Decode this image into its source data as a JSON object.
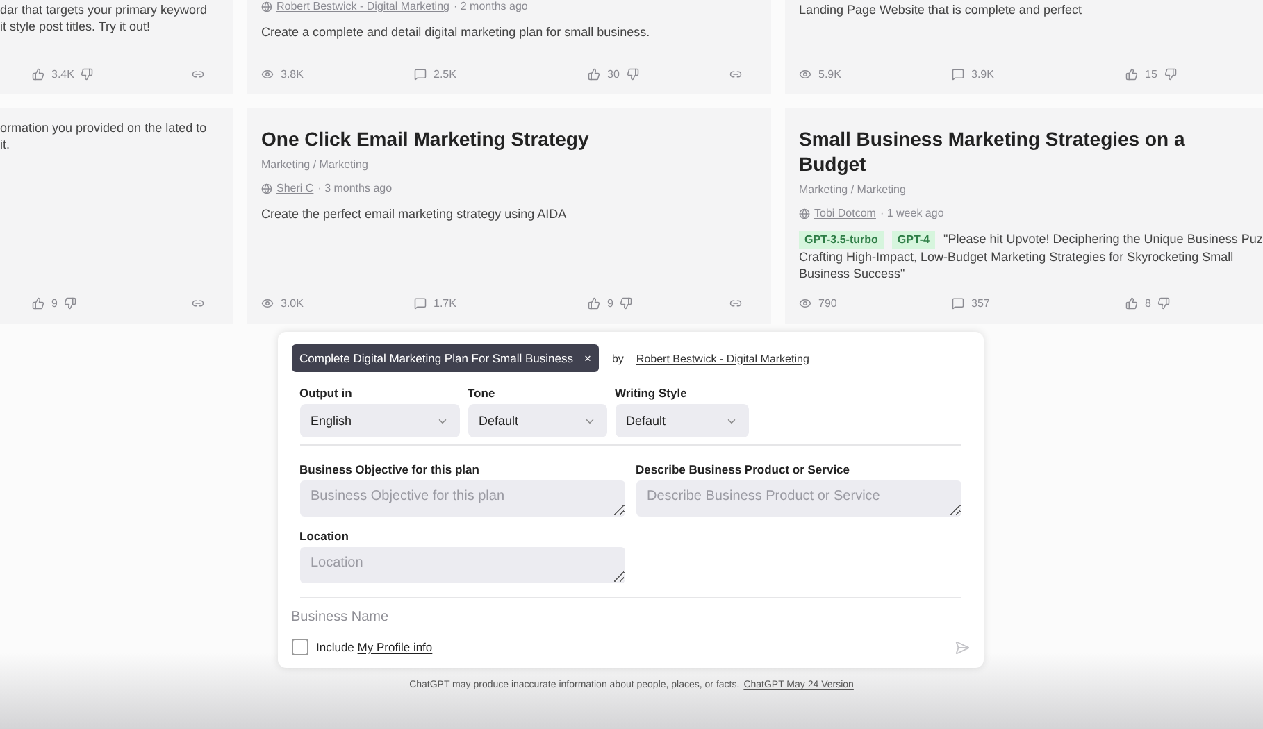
{
  "cards_top": [
    {
      "description": "dar that targets your primary keyword it style post titles. Try it out!",
      "stats": {
        "likes": "3.4K"
      }
    },
    {
      "author": "Robert Bestwick - Digital Marketing",
      "time": "· 2 months ago",
      "description": "Create a complete and detail digital marketing plan for small business.",
      "stats": {
        "views": "3.8K",
        "comments": "2.5K",
        "likes": "30"
      }
    },
    {
      "description": "Landing Page Website that is complete and perfect",
      "stats": {
        "views": "5.9K",
        "comments": "3.9K",
        "likes": "15"
      }
    }
  ],
  "cards_bottom": [
    {
      "description": "ormation you provided on the lated to it.",
      "stats": {
        "likes": "9"
      }
    },
    {
      "title": "One Click Email Marketing Strategy",
      "category": "Marketing / Marketing",
      "author": "Sheri C",
      "time": "· 3 months ago",
      "description": "Create the perfect email marketing strategy using AIDA",
      "stats": {
        "views": "3.0K",
        "comments": "1.7K",
        "likes": "9"
      }
    },
    {
      "title": "Small Business Marketing Strategies on a Budget",
      "category": "Marketing / Marketing",
      "author": "Tobi Dotcom",
      "time": "· 1 week ago",
      "tags": [
        "GPT-3.5-turbo",
        "GPT-4"
      ],
      "description": "\"Please hit Upvote! Deciphering the Unique Business Puz Crafting High-Impact, Low-Budget Marketing Strategies for Skyrocketing Small Business Success\"",
      "stats": {
        "views": "790",
        "comments": "357",
        "likes": "8"
      }
    }
  ],
  "prompt_panel": {
    "chip": "Complete Digital Marketing Plan For Small Business",
    "chip_close": "×",
    "by": "by",
    "author": "Robert Bestwick - Digital Marketing",
    "selects": [
      {
        "label": "Output in",
        "value": "English"
      },
      {
        "label": "Tone",
        "value": "Default"
      },
      {
        "label": "Writing Style",
        "value": "Default"
      }
    ],
    "fields": [
      {
        "label": "Business Objective for this plan",
        "placeholder": "Business Objective for this plan"
      },
      {
        "label": "Describe Business Product or Service",
        "placeholder": "Describe Business Product or Service"
      },
      {
        "label": "Location",
        "placeholder": "Location"
      }
    ],
    "message": {
      "placeholder": "Business Name"
    },
    "include": {
      "checked": false,
      "label": "Include",
      "link": "My Profile info"
    }
  },
  "footer": {
    "text": "ChatGPT may produce inaccurate information about people, places, or facts.",
    "link": "ChatGPT May 24 Version"
  }
}
